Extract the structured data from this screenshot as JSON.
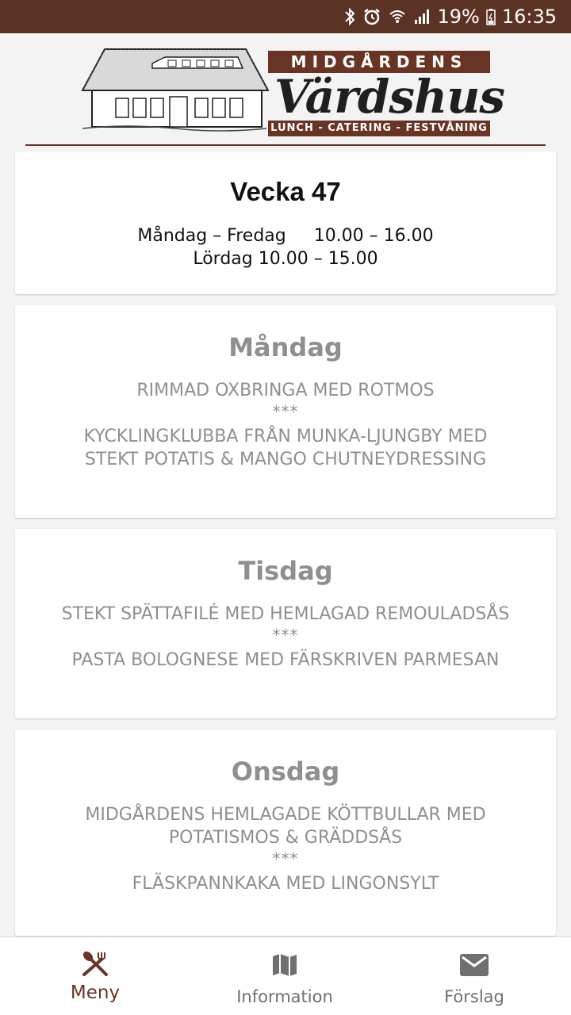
{
  "status_bar": {
    "battery": "19%",
    "time": "16:35",
    "icons": [
      "bluetooth-icon",
      "alarm-icon",
      "wifi-icon",
      "signal-icon",
      "battery-icon"
    ],
    "background": "#5a3325"
  },
  "logo": {
    "top_text": "MIDGÅRDENS",
    "script_text": "Värdshus",
    "tagline": "LUNCH - CATERING - FESTVÅNING"
  },
  "week": {
    "title": "Vecka 47",
    "hours_weekday": "Måndag – Fredag     10.00 – 16.00",
    "hours_saturday": "Lördag 10.00 – 15.00"
  },
  "days": [
    {
      "name": "Måndag",
      "dish_1": "RIMMAD OXBRINGA MED ROTMOS",
      "separator": "***",
      "dish_2_line_1": "KYCKLINGKLUBBA FRÅN MUNKA-LJUNGBY MED",
      "dish_2_line_2": "STEKT POTATIS & MANGO CHUTNEYDRESSING"
    },
    {
      "name": "Tisdag",
      "dish_1": "STEKT SPÄTTAFILÉ MED HEMLAGAD REMOULADSÅS",
      "separator": "***",
      "dish_2": "PASTA BOLOGNESE MED FÄRSKRIVEN PARMESAN"
    },
    {
      "name": "Onsdag",
      "dish_1_line_1": "MIDGÅRDENS HEMLAGADE KÖTTBULLAR MED",
      "dish_1_line_2": "POTATISMOS & GRÄDDSÅS",
      "separator": "***",
      "dish_2": "FLÄSKPANNKAKA MED LINGONSYLT"
    }
  ],
  "nav": {
    "items": [
      {
        "label": "Meny",
        "icon": "fork-knife-icon",
        "active": true
      },
      {
        "label": "Information",
        "icon": "map-icon",
        "active": false
      },
      {
        "label": "Förslag",
        "icon": "mail-icon",
        "active": false
      }
    ],
    "active_color": "#6a3424",
    "inactive_color": "#6f6f6f"
  },
  "colors": {
    "brand_brown": "#6a3424",
    "muted_text": "#8f8f8f"
  }
}
